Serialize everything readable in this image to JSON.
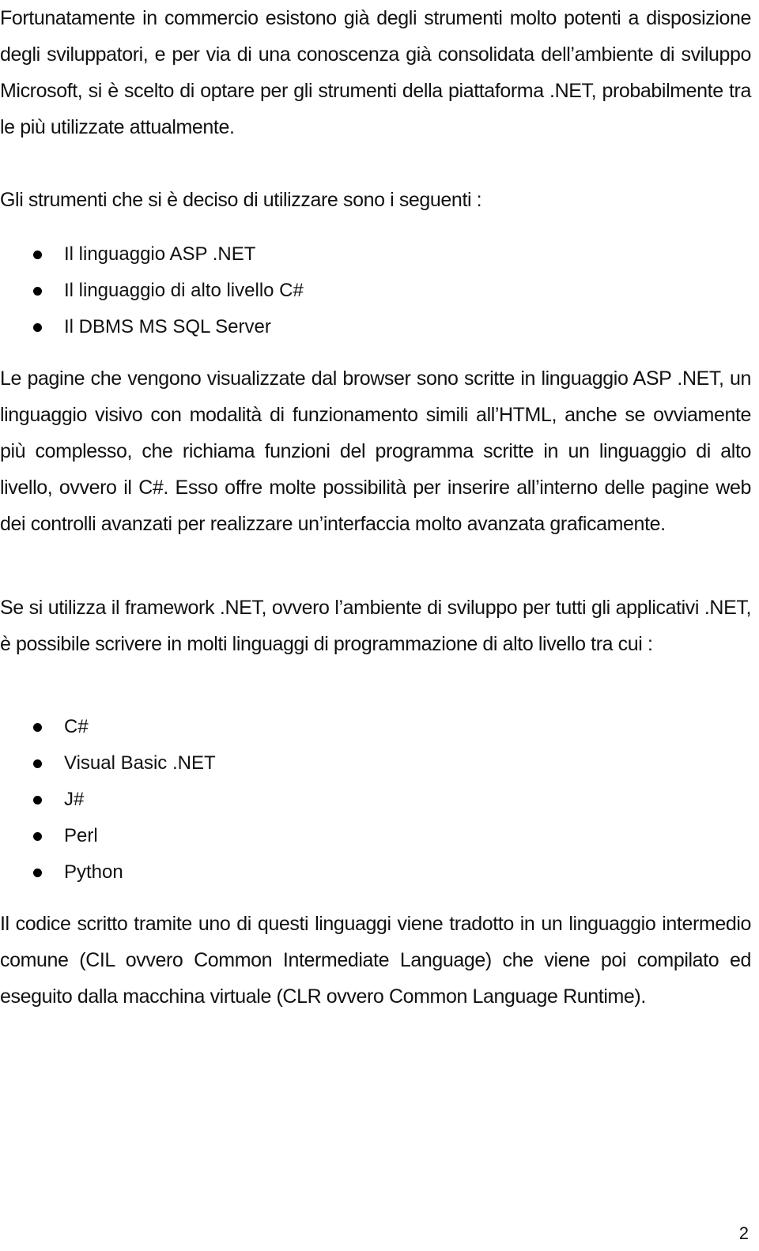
{
  "document": {
    "intro_paragraph": "Fortunatamente in commercio esistono già degli strumenti molto potenti a disposizione degli sviluppatori, e per via di una conoscenza già consolidata dell’ambiente di sviluppo Microsoft, si è scelto di optare per gli strumenti della piattaforma .NET, probabilmente tra le più utilizzate attualmente.",
    "tools_heading": "Gli strumenti che si è deciso di utilizzare sono i seguenti :",
    "tools_list": [
      "Il linguaggio ASP .NET",
      "Il linguaggio di alto livello C#",
      "Il DBMS MS SQL Server"
    ],
    "asp_paragraph": "Le pagine che vengono visualizzate dal browser sono scritte in linguaggio ASP .NET, un linguaggio visivo con modalità di funzionamento simili all’HTML, anche se ovviamente più complesso, che richiama funzioni del programma scritte in un linguaggio di alto livello, ovvero il C#. Esso offre molte possibilità per inserire all’interno delle pagine web dei controlli avanzati per realizzare un’interfaccia molto avanzata graficamente.",
    "framework_paragraph": "Se si utilizza il framework .NET, ovvero l’ambiente di sviluppo per tutti gli applicativi .NET, è possibile scrivere in molti linguaggi di programmazione di alto livello tra cui :",
    "languages_list": [
      "C#",
      "Visual Basic .NET",
      "J#",
      "Perl",
      "Python"
    ],
    "cil_paragraph": "Il codice scritto tramite uno di questi linguaggi viene tradotto in un linguaggio intermedio comune (CIL ovvero Common Intermediate Language) che viene poi compilato ed eseguito dalla macchina virtuale (CLR ovvero Common Language Runtime).",
    "page_number": "2"
  }
}
